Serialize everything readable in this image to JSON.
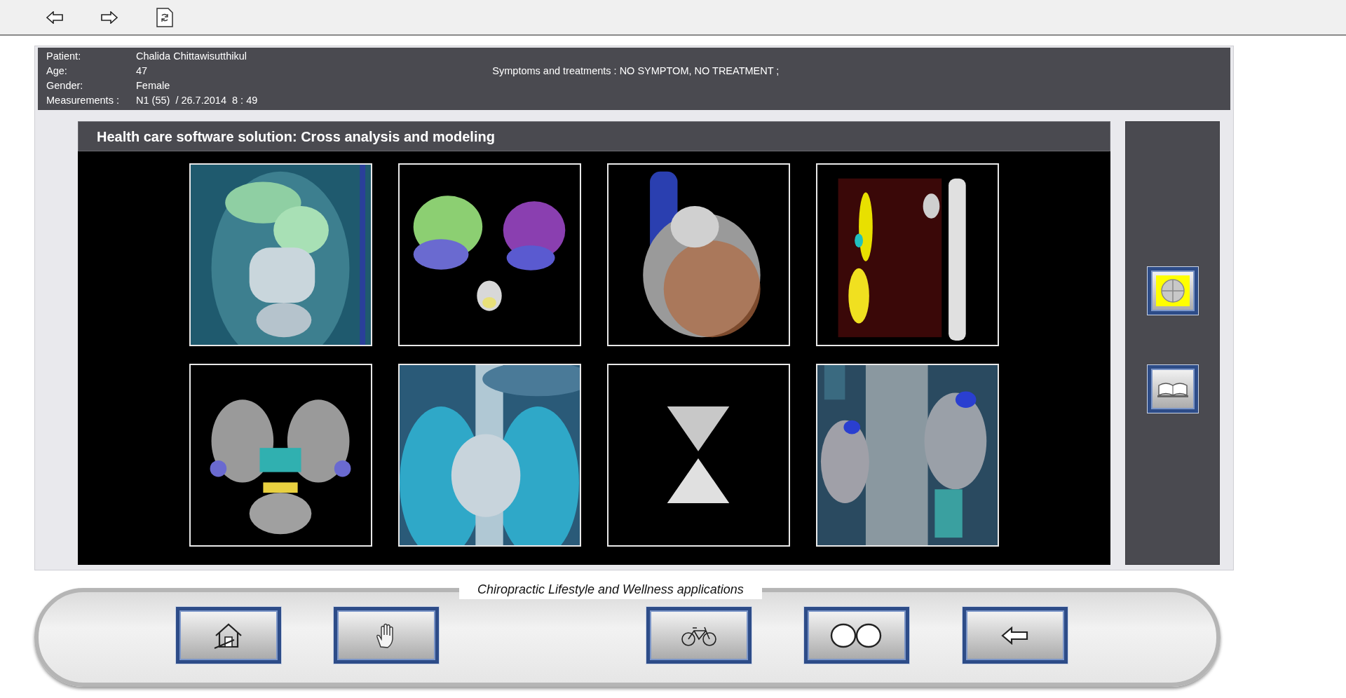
{
  "patient": {
    "fields": [
      {
        "label": "Patient:",
        "value": "Chalida Chittawisutthikul"
      },
      {
        "label": "Age:",
        "value": "47"
      },
      {
        "label": "Gender:",
        "value": "Female"
      },
      {
        "label": "Measurements :",
        "value": "N1 (55)  / 26.7.2014  8 : 49"
      }
    ],
    "symptoms": "Symptoms and treatments : NO SYMPTOM, NO TREATMENT ;"
  },
  "panel": {
    "title": "Health care software solution: Cross analysis and modeling"
  },
  "footer": {
    "caption": "Chiropractic Lifestyle and Wellness applications"
  }
}
